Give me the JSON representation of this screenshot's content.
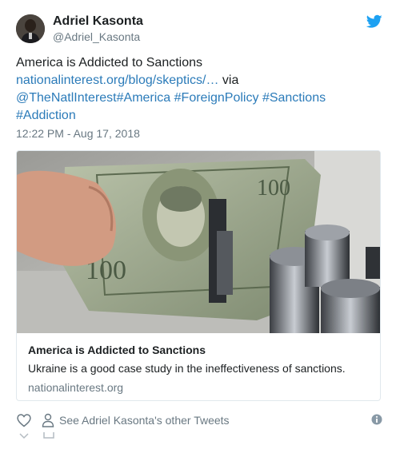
{
  "author": {
    "name": "Adriel Kasonta",
    "handle": "@Adriel_Kasonta"
  },
  "tweet": {
    "line1": "America is Addicted to Sanctions",
    "link": "nationalinterest.org/blog/skeptics/…",
    "via": " via",
    "mention": "@TheNatlInterest",
    "tag_america": "#America",
    "tag_foreignpolicy": "#ForeignPolicy",
    "tag_sanctions": "#Sanctions",
    "tag_addiction": "#Addiction",
    "timestamp": "12:22 PM - Aug 17, 2018"
  },
  "card": {
    "title": "America is Addicted to Sanctions",
    "description": "Ukraine is a good case study in the ineffectiveness of sanctions.",
    "domain": "nationalinterest.org"
  },
  "actions": {
    "see_other": "See Adriel Kasonta's other Tweets"
  },
  "colors": {
    "link": "#2b7bb9",
    "muted": "#697882",
    "twitter_blue": "#1da1f2"
  }
}
